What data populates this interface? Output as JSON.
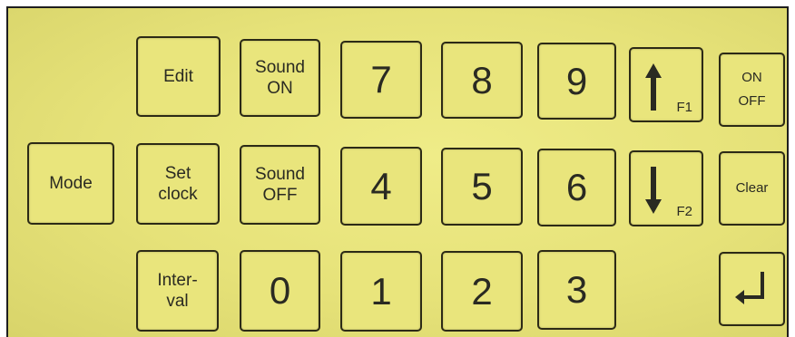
{
  "keypad": {
    "edit": "Edit",
    "sound_on": [
      "Sound",
      "ON"
    ],
    "seven": "7",
    "eight": "8",
    "nine": "9",
    "up_fn": "F1",
    "on_off": [
      "ON",
      "OFF"
    ],
    "mode": "Mode",
    "set_clock": [
      "Set",
      "clock"
    ],
    "sound_off": [
      "Sound",
      "OFF"
    ],
    "four": "4",
    "five": "5",
    "six": "6",
    "down_fn": "F2",
    "clear": "Clear",
    "interval": [
      "Inter-",
      "val"
    ],
    "zero": "0",
    "one": "1",
    "two": "2",
    "three": "3"
  },
  "icons": {
    "up": "up-arrow-icon",
    "down": "down-arrow-icon",
    "enter": "enter-return-icon"
  },
  "colors": {
    "panel": "#e6e279",
    "key_border": "#2c2a16",
    "key_text": "#2a2a22"
  }
}
